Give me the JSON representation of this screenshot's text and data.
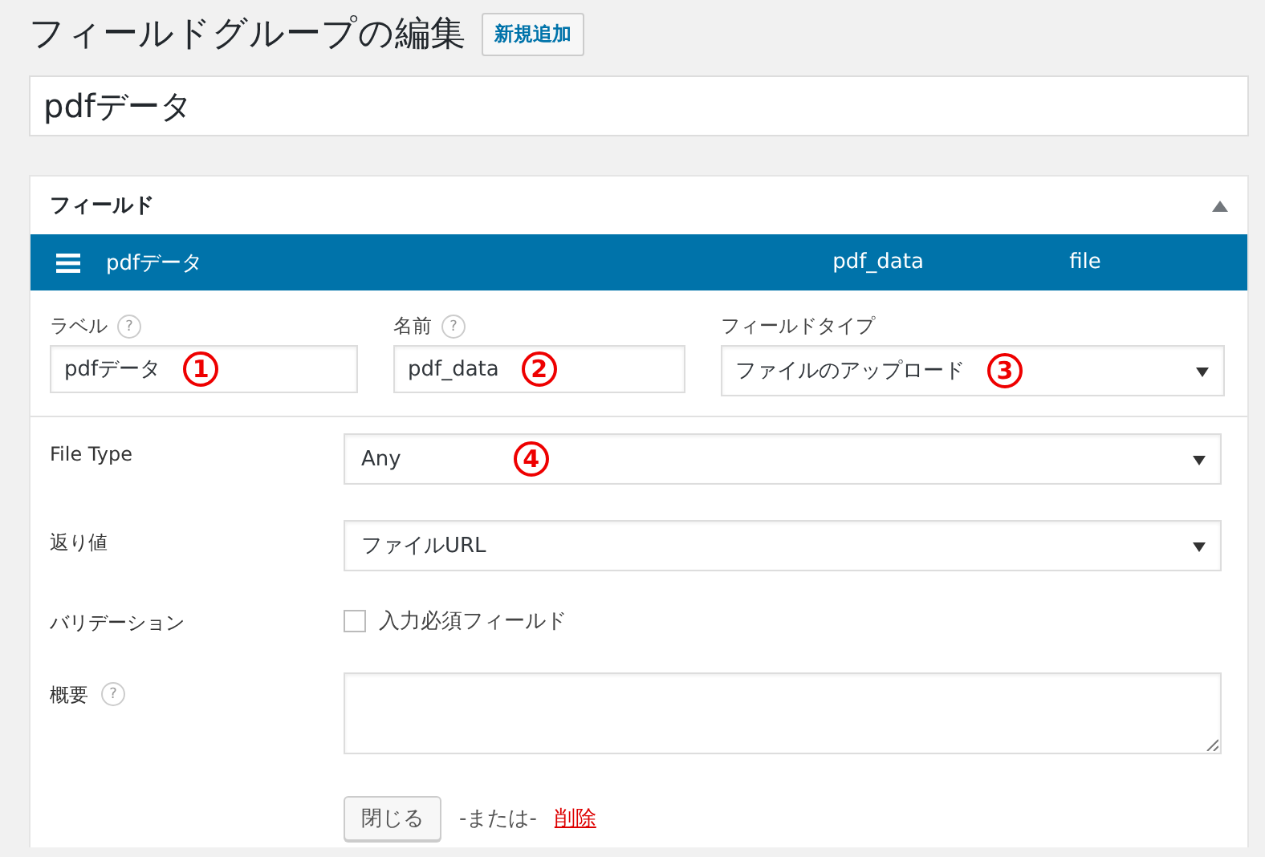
{
  "page_title": "フィールドグループの編集",
  "add_new_button": "新規追加",
  "group_title": "pdfデータ",
  "panel": {
    "title": "フィールド",
    "expanded": true,
    "field_bar": {
      "label": "pdfデータ",
      "name": "pdf_data",
      "type": "file"
    },
    "top_fields": [
      {
        "label": "ラベル",
        "help": "?",
        "kind": "input",
        "value": "pdfデータ",
        "marker": "1"
      },
      {
        "label": "名前",
        "help": "?",
        "kind": "input",
        "value": "pdf_data",
        "marker": "2"
      },
      {
        "label": "フィールドタイプ",
        "kind": "select",
        "value": "ファイルのアップロード",
        "marker": "3"
      }
    ],
    "settings": [
      {
        "label": "File Type",
        "kind": "select",
        "value": "Any",
        "marker": "4"
      },
      {
        "label": "返り値",
        "kind": "select",
        "value": "ファイルURL"
      },
      {
        "label": "バリデーション",
        "kind": "checkbox",
        "option": "入力必須フィールド",
        "checked": false
      },
      {
        "label": "概要",
        "help": "?",
        "kind": "textarea"
      }
    ],
    "close_button": "閉じる",
    "or_text": "-または-",
    "delete_link": "削除"
  }
}
